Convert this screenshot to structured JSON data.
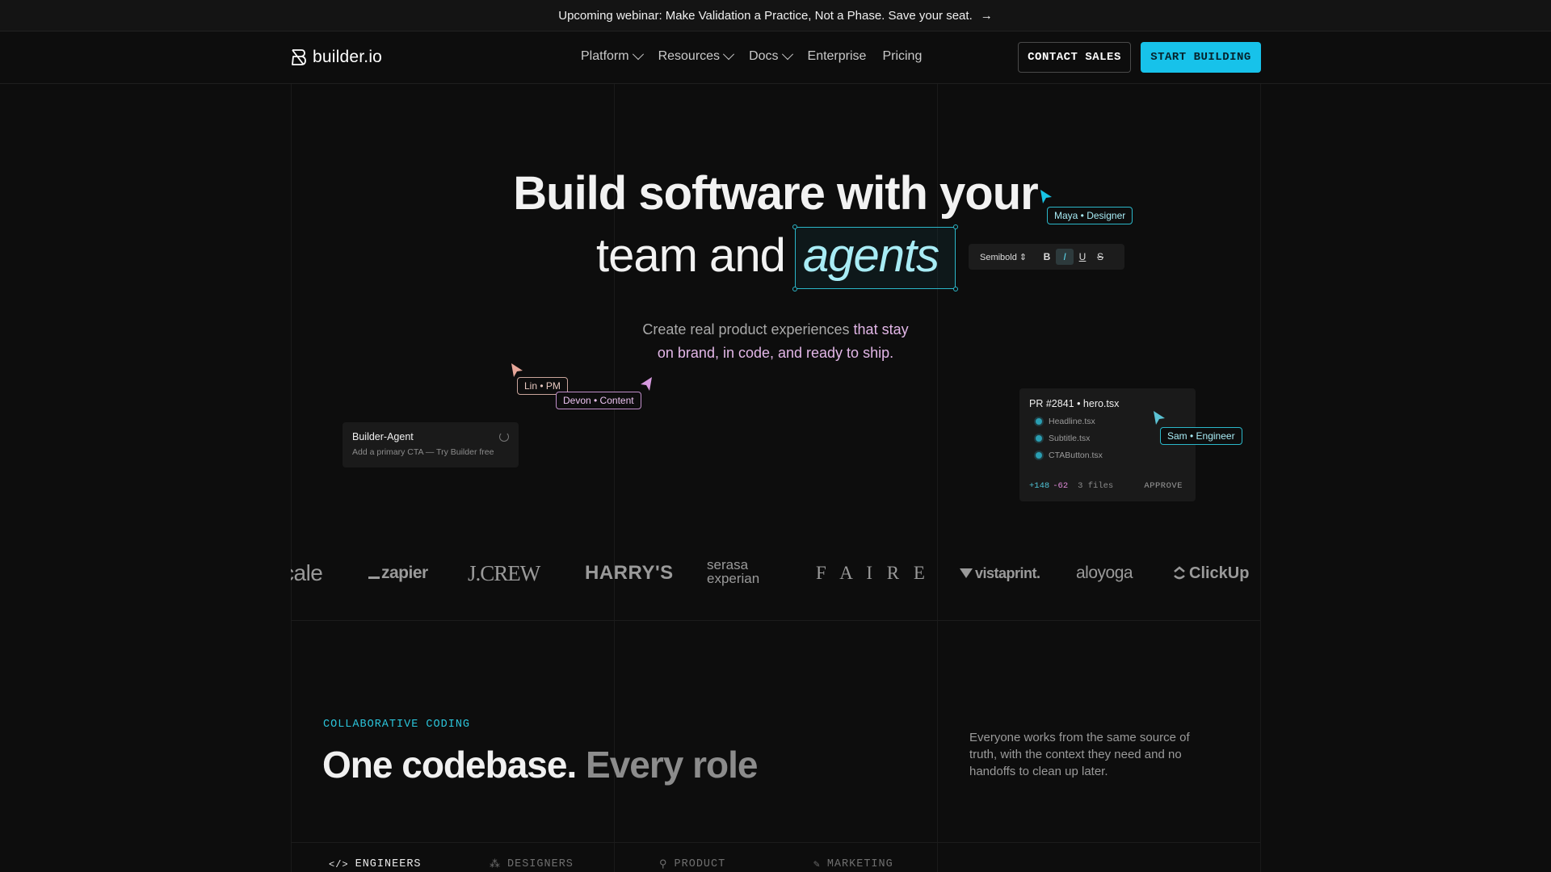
{
  "banner": {
    "text": "Upcoming webinar: Make Validation a Practice, Not a Phase. Save your seat.",
    "arrow": "→"
  },
  "nav": {
    "logo_text": "builder.io",
    "menu": [
      {
        "label": "Platform",
        "has_dropdown": true
      },
      {
        "label": "Resources",
        "has_dropdown": true
      },
      {
        "label": "Docs",
        "has_dropdown": true
      },
      {
        "label": "Enterprise",
        "has_dropdown": false
      },
      {
        "label": "Pricing",
        "has_dropdown": false
      }
    ],
    "contact_label": "CONTACT SALES",
    "start_label": "START BUILDING"
  },
  "hero": {
    "line1": "Build software with your",
    "line2": "team and",
    "highlight": "agents",
    "subtitle_plain": "Create real product experiences ",
    "subtitle_hl1": "that stay",
    "subtitle_hl2": "on brand, in code, and ready to ship."
  },
  "cursors": {
    "maya": "Maya • Designer",
    "lin": "Lin • PM",
    "devon": "Devon • Content",
    "sam": "Sam • Engineer"
  },
  "toolbar": {
    "weight": "Semibold",
    "weight_arrows": "⇕",
    "bold": "B",
    "italic": "I",
    "underline": "U",
    "strike": "S"
  },
  "agent_card": {
    "title": "Builder-Agent",
    "subtitle": "Add a primary CTA — Try Builder free"
  },
  "pr_card": {
    "title": "PR #2841 • hero.tsx",
    "files": [
      "Headline.tsx",
      "Subtitle.tsx",
      "CTAButton.tsx"
    ],
    "additions": "+148",
    "deletions": "-62",
    "files_count": "3 files",
    "approve_label": "APPROVE"
  },
  "logos": [
    "cale",
    "zapier",
    "J.CREW",
    "HARRY'S",
    "serasa experian",
    "F A I R E",
    "vistaprint.",
    "aloyoga",
    "ClickUp"
  ],
  "section": {
    "eyebrow": "COLLABORATIVE CODING",
    "title_main": "One codebase.",
    "title_dim": "Every role",
    "description": "Everyone works from the same source of truth, with the context they need and no handoffs to clean up later.",
    "tabs": [
      {
        "label": "ENGINEERS",
        "active": true
      },
      {
        "label": "DESIGNERS",
        "active": false
      },
      {
        "label": "PRODUCT",
        "active": false
      },
      {
        "label": "MARKETING",
        "active": false
      }
    ]
  },
  "colors": {
    "accent": "#17c2ea",
    "highlight_pink": "#e3b7e8",
    "background": "#0d0d0d"
  }
}
